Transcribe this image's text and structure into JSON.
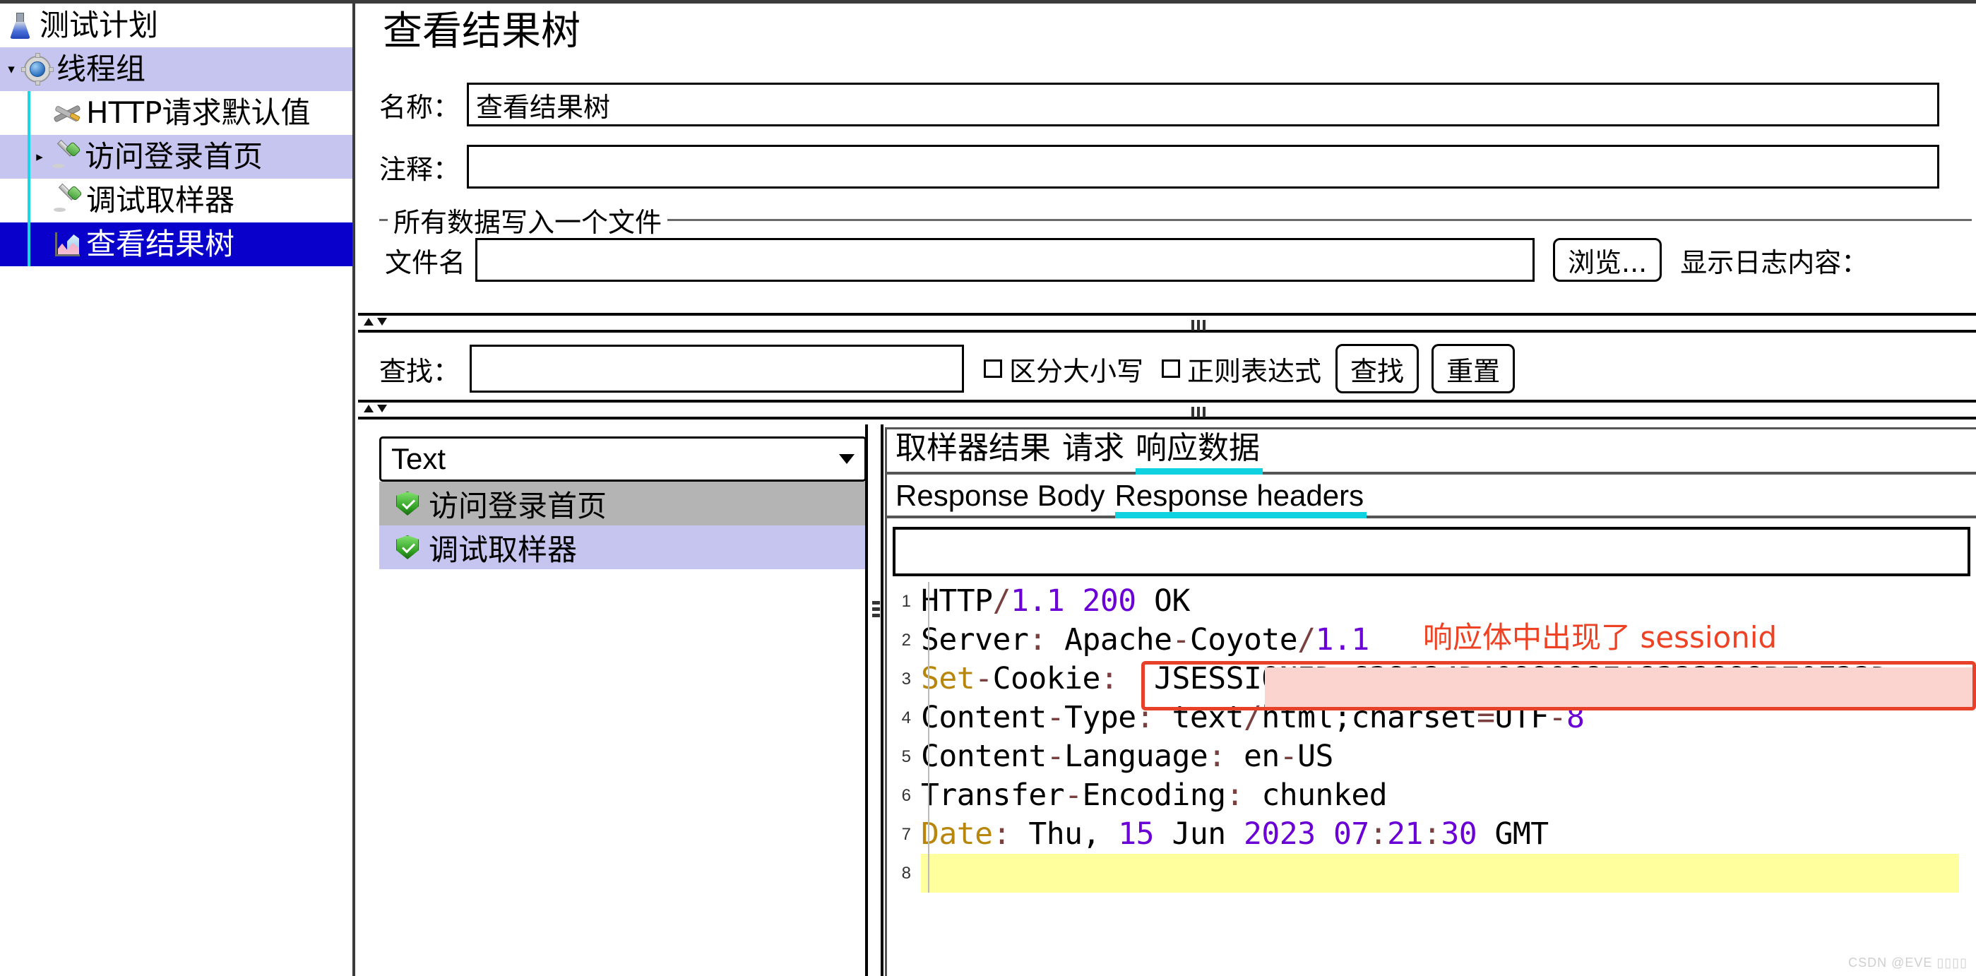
{
  "app": {
    "watermark": "CSDN @EVE ▯▯▯▯"
  },
  "sidebar": {
    "items": [
      {
        "label": "测试计划",
        "icon": "flask-icon",
        "state": "normal",
        "indent": 0,
        "toggle": ""
      },
      {
        "label": "线程组",
        "icon": "gear-icon",
        "state": "highlight",
        "indent": 0,
        "toggle": "▾"
      },
      {
        "label": "HTTP请求默认值",
        "icon": "tools-icon",
        "state": "normal",
        "indent": 1,
        "toggle": ""
      },
      {
        "label": "访问登录首页",
        "icon": "pipette-icon",
        "state": "highlight",
        "indent": 1,
        "toggle": "▸"
      },
      {
        "label": "调试取样器",
        "icon": "pipette-icon",
        "state": "normal",
        "indent": 1,
        "toggle": ""
      },
      {
        "label": "查看结果树",
        "icon": "results-chart-icon",
        "state": "selected",
        "indent": 1,
        "toggle": ""
      }
    ]
  },
  "main": {
    "title": "查看结果树",
    "name_label": "名称：",
    "name_value": "查看结果树",
    "comment_label": "注释：",
    "comment_value": "",
    "filegroup_title": "所有数据写入一个文件",
    "filename_label": "文件名",
    "filename_value": "",
    "browse_button": "浏览...",
    "log_display_label": "显示日志内容："
  },
  "search": {
    "label": "查找：",
    "value": "",
    "case_sensitive_label": "区分大小写",
    "regex_label": "正则表达式",
    "find_button": "查找",
    "reset_button": "重置"
  },
  "results": {
    "render_selected": "Text",
    "render_options": [
      "Text"
    ],
    "items": [
      {
        "label": "访问登录首页",
        "status": "success",
        "state": "selected"
      },
      {
        "label": "调试取样器",
        "status": "success",
        "state": "highlight"
      }
    ]
  },
  "response": {
    "tabs": [
      {
        "label": "取样器结果",
        "active": false
      },
      {
        "label": "请求",
        "active": false
      },
      {
        "label": "响应数据",
        "active": true
      }
    ],
    "subtabs": [
      {
        "label": "Response Body",
        "active": false
      },
      {
        "label": "Response headers",
        "active": true
      }
    ],
    "search_value": "",
    "lines": [
      {
        "n": "1",
        "tokens": [
          {
            "t": "HTTP",
            "c": "txt"
          },
          {
            "t": "/",
            "c": "pun"
          },
          {
            "t": "1.1 200",
            "c": "num"
          },
          {
            "t": " OK",
            "c": "txt"
          }
        ]
      },
      {
        "n": "2",
        "tokens": [
          {
            "t": "Server",
            "c": "txt"
          },
          {
            "t": ":",
            "c": "pun"
          },
          {
            "t": " Apache",
            "c": "txt"
          },
          {
            "t": "-",
            "c": "pun"
          },
          {
            "t": "Coyote",
            "c": "txt"
          },
          {
            "t": "/",
            "c": "pun"
          },
          {
            "t": "1.1",
            "c": "num"
          }
        ]
      },
      {
        "n": "3",
        "tokens": [
          {
            "t": "Set",
            "c": "key"
          },
          {
            "t": "-",
            "c": "pun"
          },
          {
            "t": "Cookie",
            "c": "txt"
          },
          {
            "t": ":",
            "c": "pun"
          },
          {
            "t": "  JSESSIONID",
            "c": "txt"
          },
          {
            "t": "=",
            "c": "pun"
          },
          {
            "t": "638124D4099098EA8222899B70F22D",
            "c": "txt"
          }
        ]
      },
      {
        "n": "4",
        "tokens": [
          {
            "t": "Content",
            "c": "txt"
          },
          {
            "t": "-",
            "c": "pun"
          },
          {
            "t": "Type",
            "c": "txt"
          },
          {
            "t": ":",
            "c": "pun"
          },
          {
            "t": " text",
            "c": "txt"
          },
          {
            "t": "/",
            "c": "pun"
          },
          {
            "t": "html;charset",
            "c": "txt"
          },
          {
            "t": "=",
            "c": "pun"
          },
          {
            "t": "UTF",
            "c": "txt"
          },
          {
            "t": "-",
            "c": "pun"
          },
          {
            "t": "8",
            "c": "num"
          }
        ]
      },
      {
        "n": "5",
        "tokens": [
          {
            "t": "Content",
            "c": "txt"
          },
          {
            "t": "-",
            "c": "pun"
          },
          {
            "t": "Language",
            "c": "txt"
          },
          {
            "t": ":",
            "c": "pun"
          },
          {
            "t": " en",
            "c": "txt"
          },
          {
            "t": "-",
            "c": "pun"
          },
          {
            "t": "US",
            "c": "txt"
          }
        ]
      },
      {
        "n": "6",
        "tokens": [
          {
            "t": "Transfer",
            "c": "txt"
          },
          {
            "t": "-",
            "c": "pun"
          },
          {
            "t": "Encoding",
            "c": "txt"
          },
          {
            "t": ":",
            "c": "pun"
          },
          {
            "t": " chunked",
            "c": "txt"
          }
        ]
      },
      {
        "n": "7",
        "tokens": [
          {
            "t": "Date",
            "c": "key"
          },
          {
            "t": ":",
            "c": "pun"
          },
          {
            "t": " Thu, ",
            "c": "txt"
          },
          {
            "t": "15",
            "c": "num"
          },
          {
            "t": " Jun ",
            "c": "txt"
          },
          {
            "t": "2023 07",
            "c": "num"
          },
          {
            "t": ":",
            "c": "pun"
          },
          {
            "t": "21",
            "c": "num"
          },
          {
            "t": ":",
            "c": "pun"
          },
          {
            "t": "30",
            "c": "num"
          },
          {
            "t": " GMT",
            "c": "txt"
          }
        ]
      },
      {
        "n": "8",
        "tokens": [
          {
            "t": "",
            "c": "txt"
          }
        ],
        "highlight": true
      }
    ]
  },
  "annotation": {
    "text": "响应体中出现了 sessionid",
    "color": "#ef4123"
  }
}
